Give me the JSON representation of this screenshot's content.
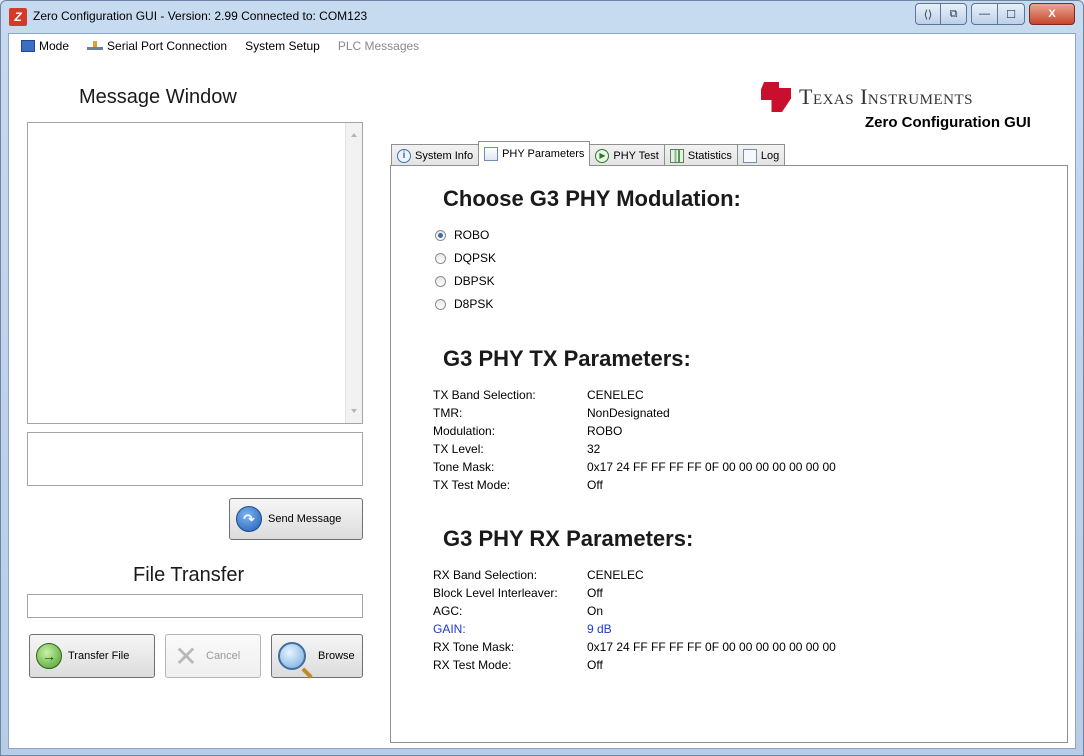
{
  "window": {
    "title": "Zero Configuration GUI - Version: 2.99    Connected to: COM123",
    "app_icon_glyph": "Z",
    "controls": {
      "a": "⟨⟩",
      "b": "⧉",
      "minimize": "—",
      "maximize": "☐",
      "close": "X"
    }
  },
  "menu": {
    "mode": "Mode",
    "serial_port": "Serial Port Connection",
    "system_setup": "System Setup",
    "plc_messages": "PLC Messages"
  },
  "left": {
    "message_window_title": "Message Window",
    "send_button": "Send Message",
    "file_transfer_title": "File Transfer",
    "transfer_button": "Transfer File",
    "cancel_button": "Cancel",
    "browse_button": "Browse"
  },
  "logo": {
    "brand": "Texas Instruments",
    "subtitle": "Zero Configuration GUI",
    "brand_color": "#c8102e"
  },
  "tabs": [
    "System Info",
    "PHY Parameters",
    "PHY Test",
    "Statistics",
    "Log"
  ],
  "active_tab": "PHY Parameters",
  "phy": {
    "modulation_heading": "Choose G3 PHY Modulation:",
    "modulation_options": [
      "ROBO",
      "DQPSK",
      "DBPSK",
      "D8PSK"
    ],
    "selected_modulation": "ROBO",
    "tx_heading": "G3 PHY TX Parameters:",
    "tx": [
      {
        "label": "TX Band Selection:",
        "value": "CENELEC"
      },
      {
        "label": "TMR:",
        "value": "NonDesignated"
      },
      {
        "label": "Modulation:",
        "value": "ROBO"
      },
      {
        "label": "TX Level:",
        "value": "32"
      },
      {
        "label": "Tone Mask:",
        "value": "0x17 24 FF FF FF FF 0F 00 00 00 00 00 00 00"
      },
      {
        "label": "TX Test Mode:",
        "value": "Off"
      }
    ],
    "rx_heading": "G3 PHY RX Parameters:",
    "rx": [
      {
        "label": "RX Band Selection:",
        "value": "CENELEC"
      },
      {
        "label": "Block Level Interleaver:",
        "value": "Off"
      },
      {
        "label": "AGC:",
        "value": "On"
      },
      {
        "label": "GAIN:",
        "value": "9 dB"
      },
      {
        "label": "RX Tone Mask:",
        "value": "0x17 24 FF FF FF FF 0F 00 00 00 00 00 00 00"
      },
      {
        "label": "RX Test Mode:",
        "value": "Off"
      }
    ],
    "highlight_color": "#1f38d0"
  }
}
